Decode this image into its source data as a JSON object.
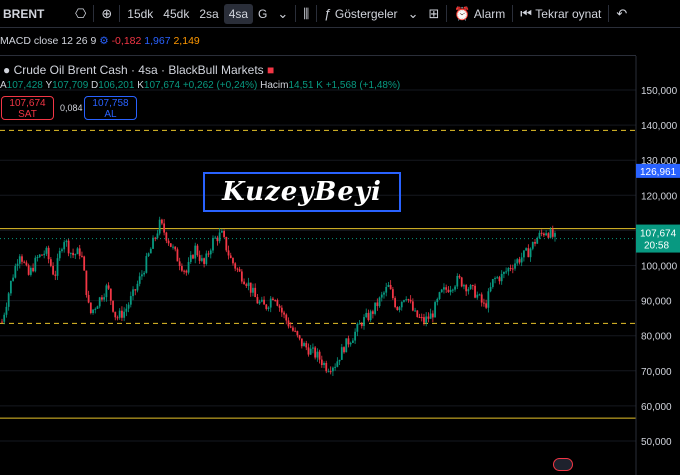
{
  "toolbar": {
    "symbol": "BRENT",
    "timeframes": [
      "15dk",
      "45dk",
      "2sa",
      "4sa",
      "G"
    ],
    "active_timeframe": "4sa",
    "indicators_label": "Göstergeler",
    "alarm_label": "Alarm",
    "replay_label": "Tekrar oynat"
  },
  "macd": {
    "label": "MACD close 12 26 9",
    "v1": "-0,182",
    "v2": "1,967",
    "v3": "2,149"
  },
  "legend": {
    "title": "Crude Oil Brent Cash · 4sa · BlackBull Markets"
  },
  "ohlc": {
    "a_k": "A",
    "a_v": "107,428",
    "y_k": "Y",
    "y_v": "107,709",
    "d_k": "D",
    "d_v": "106,201",
    "k_k": "K",
    "k_v": "107,674",
    "chg": "+0,262 (+0,24%)",
    "vol_k": "Hacim",
    "vol_v": "14,51 K",
    "vol_chg": "+1,568 (+1,48%)"
  },
  "trade": {
    "sell_price": "107,674",
    "sell_label": "SAT",
    "spread": "0,084",
    "buy_price": "107,758",
    "buy_label": "AL"
  },
  "watermark": "KuzeyBeyi",
  "colors": {
    "up": "#089981",
    "down": "#f23645",
    "accent": "#2962ff",
    "level_line": "#e6c229"
  },
  "chart_data": {
    "type": "candlestick",
    "y_axis_ticks": [
      "150,000",
      "140,000",
      "130,000",
      "120,000",
      "110,000",
      "100,000",
      "90,000",
      "80,000",
      "70,000",
      "60,000",
      "50,000"
    ],
    "ylim": [
      48,
      160
    ],
    "last_price": "107,674",
    "last_price_countdown": "20:58",
    "marker_price": "126,961",
    "close_path": [
      84,
      95,
      104,
      97,
      102,
      104,
      97,
      108,
      103,
      104,
      86,
      90,
      94,
      85,
      87,
      92,
      98,
      105,
      112,
      107,
      102,
      98,
      105,
      100,
      107,
      109,
      102,
      98,
      95,
      90,
      88,
      92,
      86,
      82,
      78,
      76,
      74,
      71,
      72,
      77,
      80,
      84,
      86,
      90,
      94,
      88,
      92,
      86,
      84,
      86,
      92,
      94,
      96,
      94,
      92,
      88,
      96,
      97,
      100,
      102,
      104,
      108,
      110,
      107.674
    ],
    "horizontal_levels": [
      {
        "price": 138.5,
        "style": "dashed"
      },
      {
        "price": 110.5,
        "style": "solid"
      },
      {
        "price": 83.5,
        "style": "dashed"
      },
      {
        "price": 56.5,
        "style": "solid"
      }
    ]
  }
}
